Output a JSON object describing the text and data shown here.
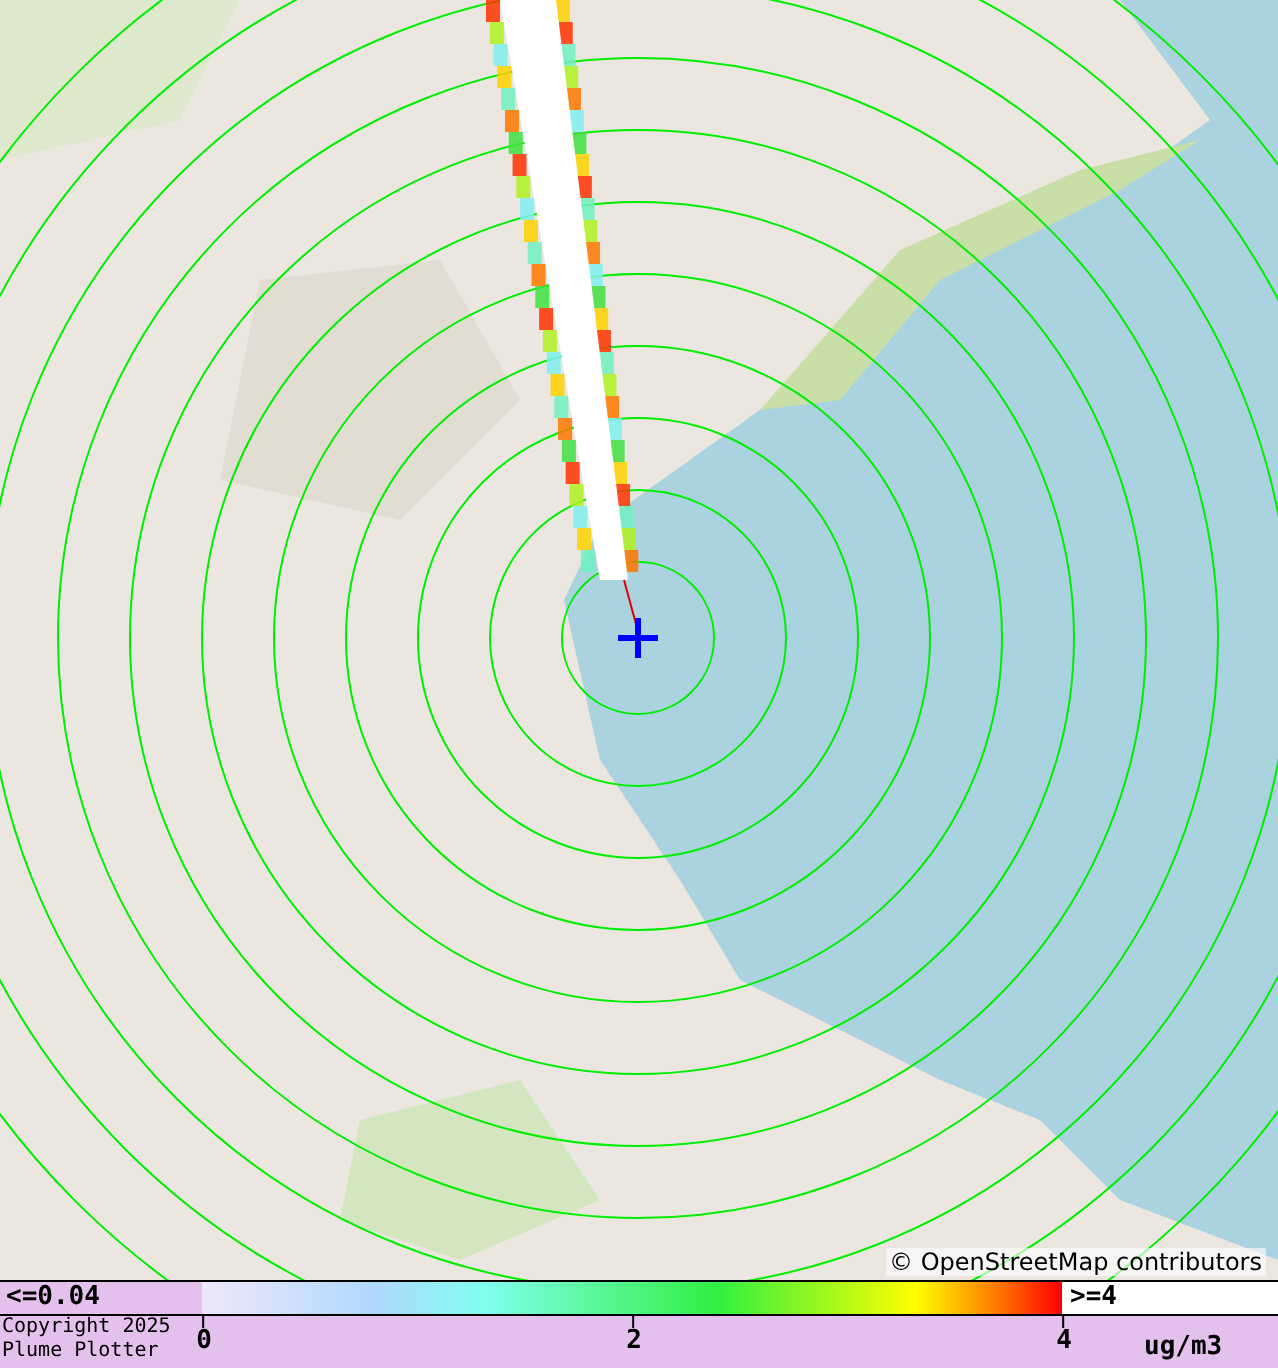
{
  "map": {
    "attribution": "© OpenStreetMap contributors"
  },
  "legend": {
    "low_label": "<=0.04",
    "high_label": ">=4",
    "ticks": [
      "0",
      "2",
      "4"
    ],
    "unit": "ug/m3"
  },
  "footer": {
    "lines": [
      "Copyright 2025",
      "Plume Plotter"
    ]
  }
}
